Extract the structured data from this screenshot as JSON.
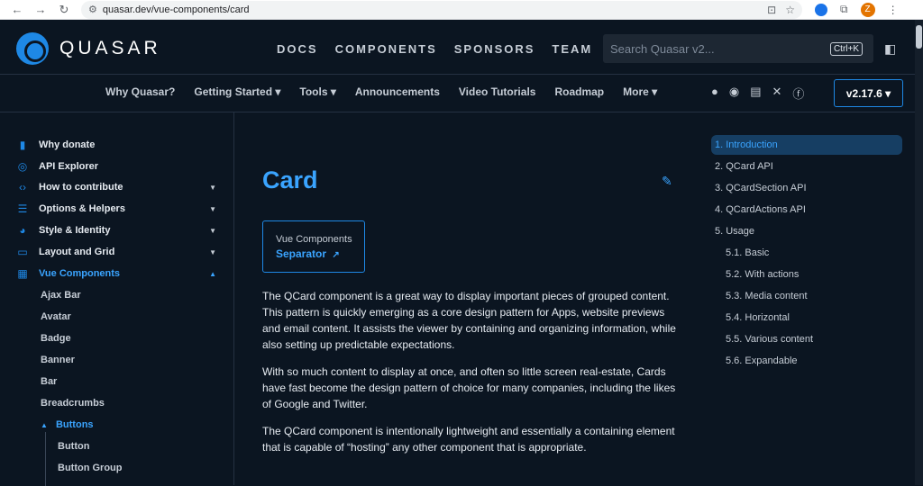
{
  "browser": {
    "url": "quasar.dev/vue-components/card",
    "profile_initial": "Z"
  },
  "header": {
    "logo_text": "QUASAR",
    "nav": [
      "DOCS",
      "COMPONENTS",
      "SPONSORS",
      "TEAM"
    ],
    "search_placeholder": "Search Quasar v2...",
    "search_shortcut": "Ctrl+K"
  },
  "subnav": {
    "links": [
      "Why Quasar?",
      "Getting Started ▾",
      "Tools ▾",
      "Announcements",
      "Video Tutorials",
      "Roadmap",
      "More ▾"
    ],
    "version": "v2.17.6 ▾"
  },
  "sidebar": {
    "items": [
      {
        "icon": "donate-icon",
        "label": "Why donate"
      },
      {
        "icon": "api-explorer-icon",
        "label": "API Explorer"
      },
      {
        "icon": "code-icon",
        "label": "How to contribute"
      },
      {
        "icon": "tune-icon",
        "label": "Options & Helpers"
      },
      {
        "icon": "palette-icon",
        "label": "Style & Identity"
      },
      {
        "icon": "layout-icon",
        "label": "Layout and Grid"
      },
      {
        "icon": "widgets-icon",
        "label": "Vue Components"
      }
    ],
    "sub_items": [
      "Ajax Bar",
      "Avatar",
      "Badge",
      "Banner",
      "Bar",
      "Breadcrumbs"
    ],
    "buttons_group": "Buttons",
    "buttons_children": [
      "Button",
      "Button Group"
    ]
  },
  "main": {
    "title": "Card",
    "related_label": "Vue Components",
    "related_link": "Separator",
    "paragraphs": [
      "The QCard component is a great way to display important pieces of grouped content. This pattern is quickly emerging as a core design pattern for Apps, website previews and email content. It assists the viewer by containing and organizing information, while also setting up predictable expectations.",
      "With so much content to display at once, and often so little screen real-estate, Cards have fast become the design pattern of choice for many companies, including the likes of Google and Twitter.",
      "The QCard component is intentionally lightweight and essentially a containing element that is capable of “hosting” any other component that is appropriate."
    ]
  },
  "toc": [
    "1. Introduction",
    "2. QCard API",
    "3. QCardSection API",
    "4. QCardActions API",
    "5. Usage",
    "5.1. Basic",
    "5.2. With actions",
    "5.3. Media content",
    "5.4. Horizontal",
    "5.5. Various content",
    "5.6. Expandable"
  ],
  "colors": {
    "background": "#0b1521",
    "accent": "#3aa4ff",
    "brand": "#1e88e5",
    "text": "#e6ebf1"
  }
}
